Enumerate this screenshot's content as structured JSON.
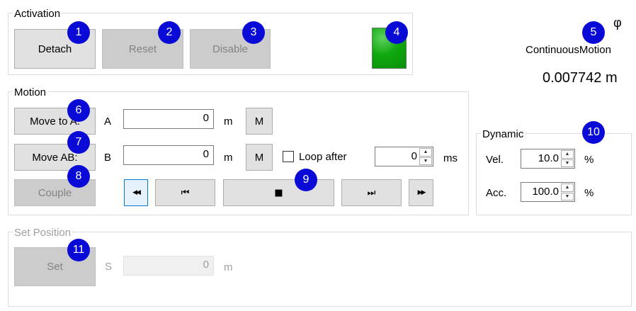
{
  "activation": {
    "title": "Activation",
    "detach_label": "Detach",
    "reset_label": "Reset",
    "disable_label": "Disable"
  },
  "status": {
    "phi_symbol": "φ",
    "mode": "ContinuousMotion",
    "position": "0.007742 m",
    "led_color": "#11a511"
  },
  "motion": {
    "title": "Motion",
    "move_to_a_label": "Move to A:",
    "move_ab_label": "Move AB:",
    "couple_label": "Couple",
    "a_label": "A",
    "b_label": "B",
    "a_value": "0",
    "b_value": "0",
    "a_unit": "m",
    "b_unit": "m",
    "m_button_a": "M",
    "m_button_b": "M",
    "loop_label": "Loop after",
    "loop_checked": false,
    "loop_value": "0",
    "loop_unit": "ms",
    "transport": {
      "rewind_icon": "◀◀",
      "skip_back_icon": "⏮",
      "stop_icon": "■",
      "skip_forward_icon": "⏭",
      "fast_forward_icon": "▶▶"
    }
  },
  "dynamic": {
    "title": "Dynamic",
    "vel_label": "Vel.",
    "vel_value": "10.0",
    "vel_unit": "%",
    "acc_label": "Acc.",
    "acc_value": "100.0",
    "acc_unit": "%"
  },
  "set_position": {
    "title": "Set Position",
    "set_label": "Set",
    "s_label": "S",
    "s_value": "0",
    "s_unit": "m"
  },
  "badges": [
    "1",
    "2",
    "3",
    "4",
    "5",
    "6",
    "7",
    "8",
    "9",
    "10",
    "11"
  ],
  "colors": {
    "badge": "#0a0ad6",
    "focus_accent": "#0078d7"
  }
}
